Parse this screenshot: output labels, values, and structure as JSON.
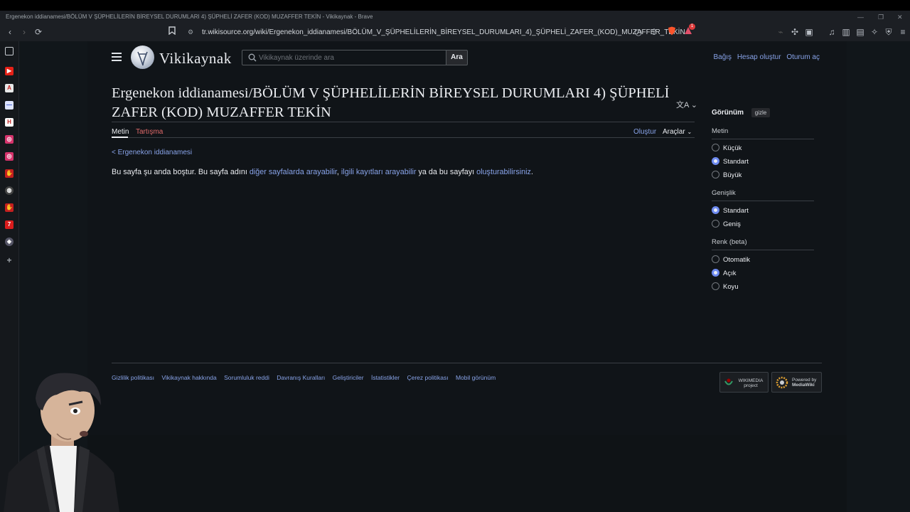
{
  "window": {
    "title": "Ergenekon iddianamesi/BÖLÜM V ŞÜPHELİLERİN BİREYSEL DURUMLARI 4) ŞÜPHELİ ZAFER (KOD) MUZAFFER TEKİN - Vikikaynak - Brave",
    "url": "tr.wikisource.org/wiki/Ergenekon_iddianamesi/BÖLÜM_V_ŞÜPHELİLERİN_BİREYSEL_DURUMLARI_4)_ŞÜPHELİ_ZAFER_(KOD)_MUZAFFER_TEKİN",
    "notification_count": "1"
  },
  "sidebar": {
    "icons": [
      "sidebar-panel-icon",
      "youtube-icon",
      "app-a-icon",
      "app-dash-icon",
      "app-h-icon",
      "app-instagram-icon",
      "app-instagram2-icon",
      "app-hand-icon",
      "app-globe-icon",
      "app-hand2-icon",
      "app-seven-icon",
      "app-shield-icon",
      "add-icon"
    ]
  },
  "site": {
    "logo_text": "Vikikaynak",
    "search_placeholder": "Vikikaynak üzerinde ara",
    "search_button": "Ara",
    "user_links": [
      "Bağış",
      "Hesap oluştur",
      "Oturum aç"
    ]
  },
  "article": {
    "title": "Ergenekon iddianamesi/BÖLÜM V ŞÜPHELİLERİN BİREYSEL DURUMLARI 4) ŞÜPHELİ ZAFER (KOD) MUZAFFER TEKİN",
    "tabs": {
      "text": "Metin",
      "talk": "Tartışma",
      "create": "Oluştur",
      "tools": "Araçlar"
    },
    "backlink": "< Ergenekon iddianamesi",
    "body": {
      "part1": "Bu sayfa şu anda boştur. Bu sayfa adını ",
      "link1": "diğer sayfalarda arayabilir",
      "sep": ", ",
      "link2": "ilgili kayıtları arayabilir",
      "part2": " ya da bu sayfayı ",
      "link3": "oluşturabilirsiniz",
      "end": "."
    }
  },
  "appearance": {
    "heading": "Görünüm",
    "hide": "gizle",
    "groups": [
      {
        "label": "Metin",
        "options": [
          {
            "label": "Küçük",
            "checked": false
          },
          {
            "label": "Standart",
            "checked": true
          },
          {
            "label": "Büyük",
            "checked": false
          }
        ]
      },
      {
        "label": "Genişlik",
        "options": [
          {
            "label": "Standart",
            "checked": true
          },
          {
            "label": "Geniş",
            "checked": false
          }
        ]
      },
      {
        "label": "Renk (beta)",
        "options": [
          {
            "label": "Otomatik",
            "checked": false
          },
          {
            "label": "Açık",
            "checked": true
          },
          {
            "label": "Koyu",
            "checked": false
          }
        ]
      }
    ]
  },
  "footer": {
    "links": [
      "Gizlilik politikası",
      "Vikikaynak hakkında",
      "Sorumluluk reddi",
      "Davranış Kuralları",
      "Geliştiriciler",
      "İstatistikler",
      "Çerez politikası",
      "Mobil görünüm"
    ],
    "badge_wikimedia": "WIKIMEDIA project",
    "badge_mediawiki_1": "Powered by",
    "badge_mediawiki_2": "MediaWiki"
  },
  "colors": {
    "link": "#88a3e8",
    "talk_link": "#e06a6a",
    "accent_radio": "#6d8af0",
    "brave_orange": "#fb542b"
  }
}
